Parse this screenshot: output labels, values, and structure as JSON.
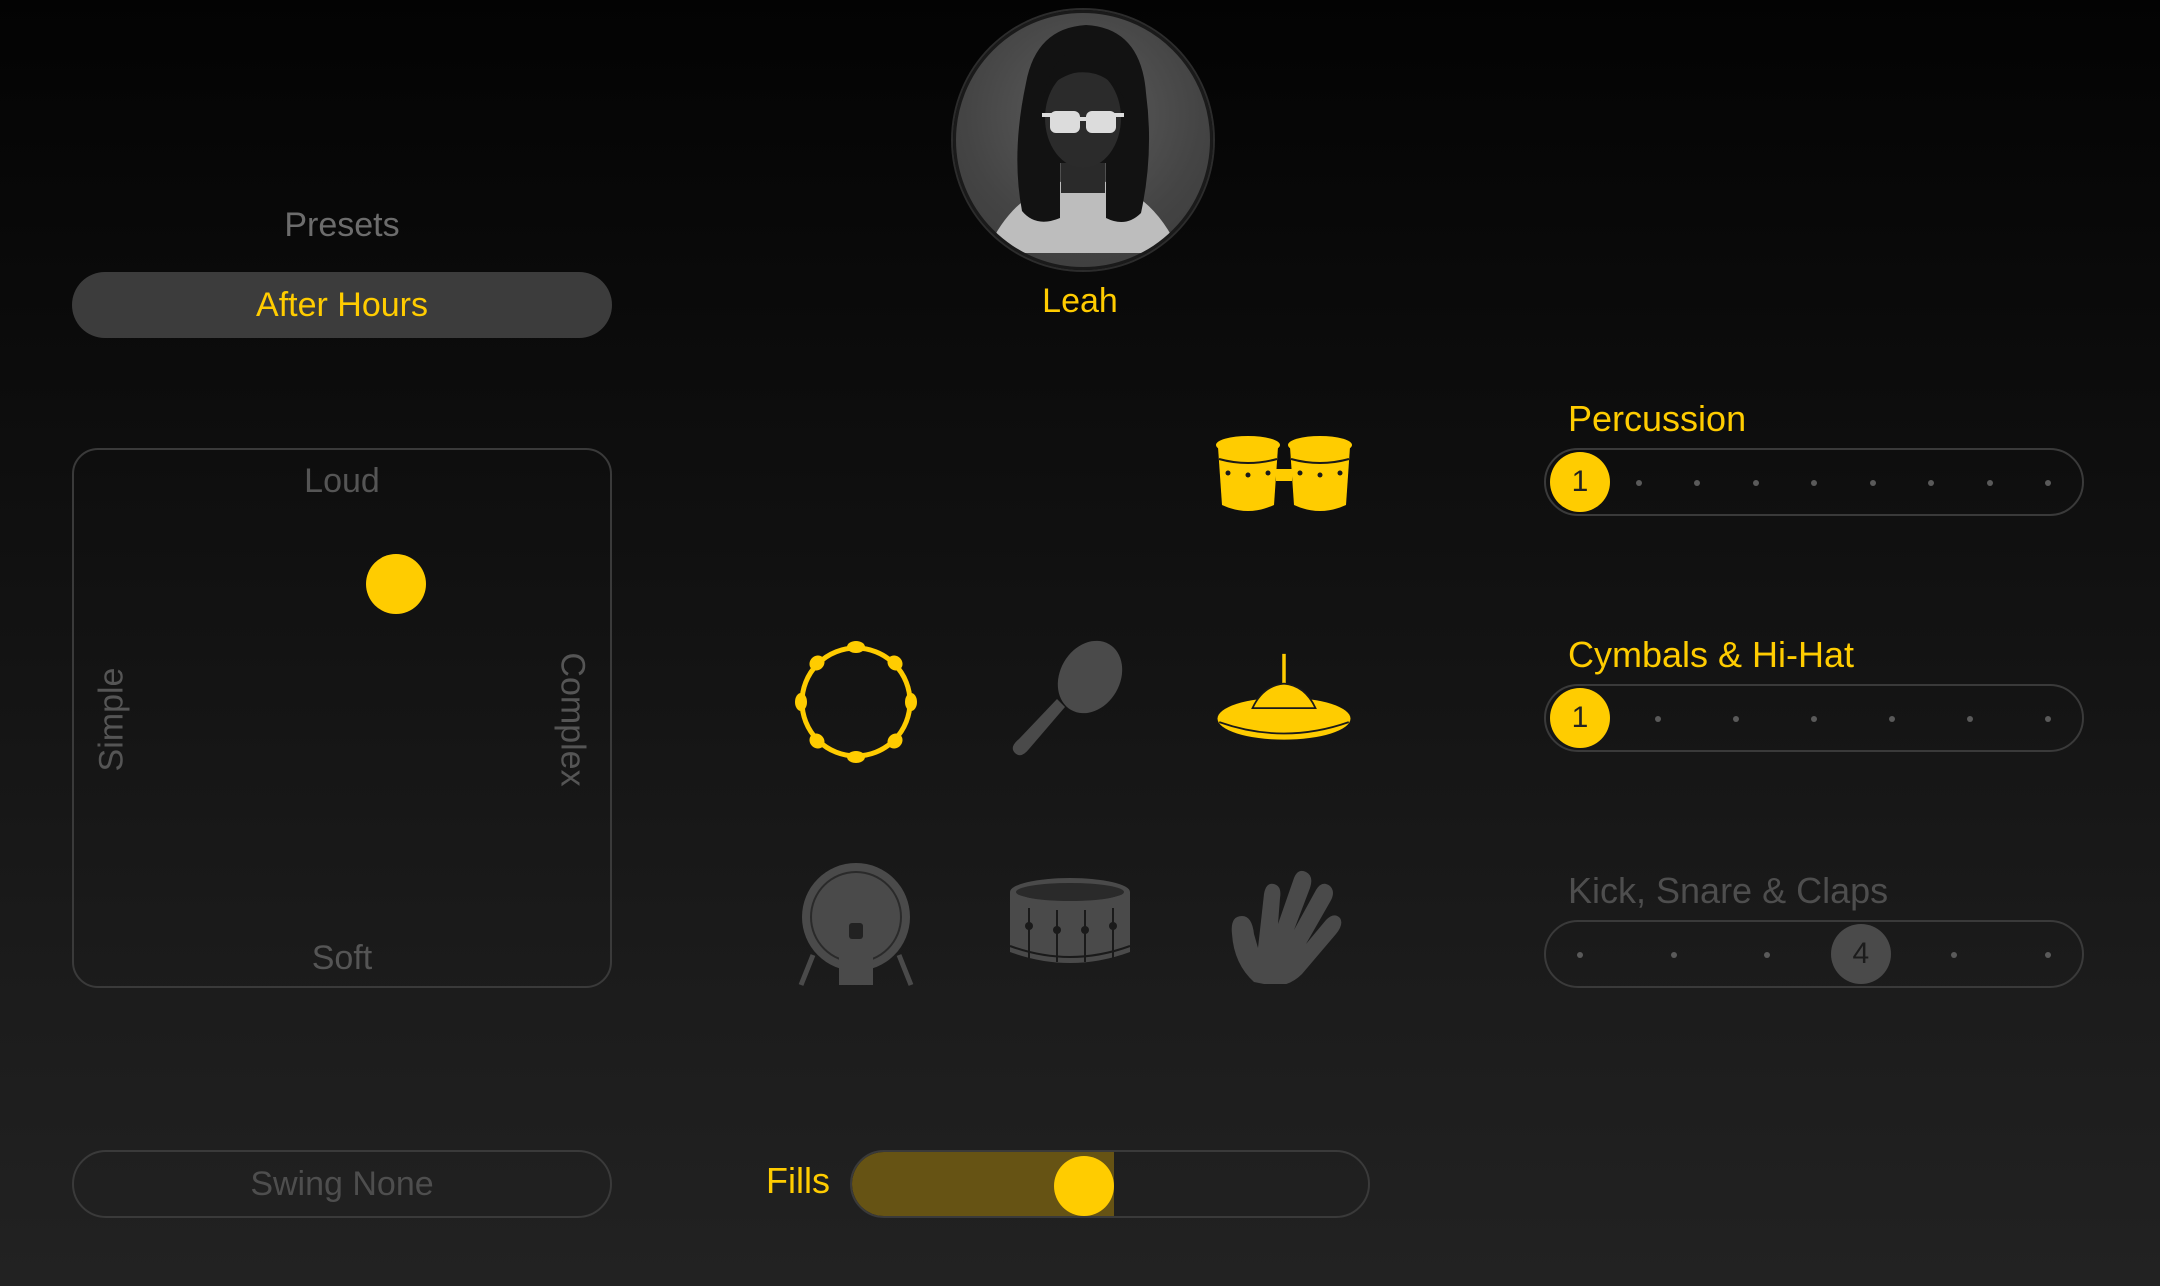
{
  "drummer": {
    "name": "Leah"
  },
  "presets": {
    "label": "Presets",
    "selected": "After Hours"
  },
  "xy_pad": {
    "top_label": "Loud",
    "bottom_label": "Soft",
    "left_label": "Simple",
    "right_label": "Complex",
    "puck": {
      "complexity": 0.6,
      "loudness": 0.75
    }
  },
  "swing": {
    "label": "Swing None"
  },
  "fills": {
    "label": "Fills",
    "level": 0.45
  },
  "instruments": [
    {
      "name": "congas",
      "active": true
    },
    {
      "name": "tambourine",
      "active": true
    },
    {
      "name": "shaker",
      "active": false
    },
    {
      "name": "cymbal",
      "active": true
    },
    {
      "name": "kick-drum",
      "active": false
    },
    {
      "name": "snare-drum",
      "active": false
    },
    {
      "name": "clap-hand",
      "active": false
    }
  ],
  "sliders": [
    {
      "label": "Percussion",
      "steps": 9,
      "value": 1,
      "value_label": "1",
      "active": true
    },
    {
      "label": "Cymbals & Hi-Hat",
      "steps": 7,
      "value": 1,
      "value_label": "1",
      "active": true
    },
    {
      "label": "Kick, Snare & Claps",
      "steps": 6,
      "value": 4,
      "value_label": "4",
      "active": false
    }
  ],
  "colors": {
    "accent": "#ffcc00",
    "inactive": "#4a4a4a",
    "fill_track": "#665314"
  }
}
